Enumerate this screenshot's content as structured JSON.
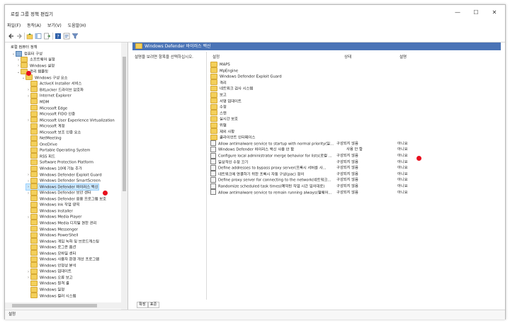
{
  "window": {
    "title": "로컬 그룹 정책 편집기",
    "minimize": "—",
    "maximize": "☐",
    "close": "✕"
  },
  "menu": [
    "파일(F)",
    "동작(A)",
    "보기(V)",
    "도움말(H)"
  ],
  "tree": [
    {
      "label": "로컬 컴퓨터 정책",
      "level": 0,
      "expander": "",
      "icon": "none"
    },
    {
      "label": "컴퓨터 구성",
      "level": 1,
      "expander": "⌄",
      "icon": "pc"
    },
    {
      "label": "소프트웨어 설정",
      "level": 2,
      "expander": "›",
      "icon": "folder"
    },
    {
      "label": "Windows 설정",
      "level": 2,
      "expander": "›",
      "icon": "folder"
    },
    {
      "label": "관리 템플릿",
      "level": 2,
      "expander": "⌄",
      "icon": "folder"
    },
    {
      "label": "Windows 구성 요소",
      "level": 3,
      "expander": "⌄",
      "icon": "folder"
    },
    {
      "label": "ActiveX Installer 서비스",
      "level": 4,
      "expander": "",
      "icon": "folder"
    },
    {
      "label": "BitLocker 드라이브 암호화",
      "level": 4,
      "expander": "›",
      "icon": "folder"
    },
    {
      "label": "Internet Explorer",
      "level": 4,
      "expander": "›",
      "icon": "folder"
    },
    {
      "label": "MDM",
      "level": 4,
      "expander": "",
      "icon": "folder"
    },
    {
      "label": "Microsoft Edge",
      "level": 4,
      "expander": "",
      "icon": "folder"
    },
    {
      "label": "Microsoft FIDO 인증",
      "level": 4,
      "expander": "",
      "icon": "folder"
    },
    {
      "label": "Microsoft User Experience Virtualization",
      "level": 4,
      "expander": "›",
      "icon": "folder"
    },
    {
      "label": "Microsoft 계정",
      "level": 4,
      "expander": "",
      "icon": "folder"
    },
    {
      "label": "Microsoft 보조 인증 요소",
      "level": 4,
      "expander": "",
      "icon": "folder"
    },
    {
      "label": "NetMeeting",
      "level": 4,
      "expander": "",
      "icon": "folder"
    },
    {
      "label": "OneDrive",
      "level": 4,
      "expander": "",
      "icon": "folder"
    },
    {
      "label": "Portable Operating System",
      "level": 4,
      "expander": "",
      "icon": "folder"
    },
    {
      "label": "RSS 피드",
      "level": 4,
      "expander": "",
      "icon": "folder"
    },
    {
      "label": "Software Protection Platform",
      "level": 4,
      "expander": "",
      "icon": "folder"
    },
    {
      "label": "Windows 10에 기능 추가",
      "level": 4,
      "expander": "",
      "icon": "folder"
    },
    {
      "label": "Windows Defender Exploit Guard",
      "level": 4,
      "expander": "›",
      "icon": "folder"
    },
    {
      "label": "Windows Defender SmartScreen",
      "level": 4,
      "expander": "›",
      "icon": "folder"
    },
    {
      "label": "Windows Defender 바이러스 백신",
      "level": 4,
      "expander": "›",
      "icon": "folder",
      "selected": true
    },
    {
      "label": "Windows Defender 보안 센터",
      "level": 4,
      "expander": "›",
      "icon": "folder"
    },
    {
      "label": "Windows Defender 응용 프로그램 보호",
      "level": 4,
      "expander": "",
      "icon": "folder"
    },
    {
      "label": "Windows Ink 작업 영역",
      "level": 4,
      "expander": "",
      "icon": "folder"
    },
    {
      "label": "Windows Installer",
      "level": 4,
      "expander": "",
      "icon": "folder"
    },
    {
      "label": "Windows Media Player",
      "level": 4,
      "expander": "›",
      "icon": "folder"
    },
    {
      "label": "Windows Media 디지털 권한 관리",
      "level": 4,
      "expander": "",
      "icon": "folder"
    },
    {
      "label": "Windows Messenger",
      "level": 4,
      "expander": "",
      "icon": "folder"
    },
    {
      "label": "Windows PowerShell",
      "level": 4,
      "expander": "",
      "icon": "folder"
    },
    {
      "label": "Windows 게임 녹화 및 브로드캐스팅",
      "level": 4,
      "expander": "",
      "icon": "folder"
    },
    {
      "label": "Windows 로그온 옵션",
      "level": 4,
      "expander": "",
      "icon": "folder"
    },
    {
      "label": "Windows 모바일 센터",
      "level": 4,
      "expander": "",
      "icon": "folder"
    },
    {
      "label": "Windows 사용자 환경 개선 프로그램",
      "level": 4,
      "expander": "",
      "icon": "folder"
    },
    {
      "label": "Windows 안정성 분석",
      "level": 4,
      "expander": "",
      "icon": "folder"
    },
    {
      "label": "Windows 업데이트",
      "level": 4,
      "expander": "›",
      "icon": "folder"
    },
    {
      "label": "Windows 오류 보고",
      "level": 4,
      "expander": "›",
      "icon": "folder"
    },
    {
      "label": "Windows 원격 셸",
      "level": 4,
      "expander": "",
      "icon": "folder"
    },
    {
      "label": "Windows 일정",
      "level": 4,
      "expander": "",
      "icon": "folder"
    },
    {
      "label": "Windows 컬러 시스템",
      "level": 4,
      "expander": "",
      "icon": "folder"
    }
  ],
  "right": {
    "header": "Windows Defender 바이러스 백신",
    "description": "설명을 보려면 항목을 선택하십시오.",
    "columns": {
      "setting": "설정",
      "state": "상태",
      "comment": "설명"
    },
    "folders": [
      "MAPS",
      "MpEngine",
      "Windows Defender Exploit Guard",
      "격리",
      "네트워크 검사 시스템",
      "보고",
      "서명 업데이트",
      "수정",
      "스캔",
      "실시간 보호",
      "위협",
      "제외 사항",
      "클라이언트 인터페이스"
    ],
    "settings": [
      {
        "name": "Allow antimalware service to startup with normal priority(일...",
        "state": "구성되지 않음",
        "comment": "아니요"
      },
      {
        "name": "Windows Defender 바이러스 백신 사용 안 함",
        "state": "사용 안 함",
        "comment": "아니요"
      },
      {
        "name": "Configure local administrator merge behavior for lists(로컬 ...",
        "state": "구성되지 않음",
        "comment": "아니요"
      },
      {
        "name": "일상적인 수정 끄기",
        "state": "구성되지 않음",
        "comment": "아니요"
      },
      {
        "name": "Define addresses to bypass proxy server(프록시 서버를 사...",
        "state": "구성되지 않음",
        "comment": "아니요"
      },
      {
        "name": "네트워크에 연결하기 위한 프록시 자동 구성(pac) 정의",
        "state": "구성되지 않음",
        "comment": "아니요"
      },
      {
        "name": "Define proxy server for connecting to the network(네트워크...",
        "state": "구성되지 않음",
        "comment": "아니요"
      },
      {
        "name": "Randomize scheduled task times(예약된 작업 시간 임의대로)",
        "state": "구성되지 않음",
        "comment": "아니요"
      },
      {
        "name": "Allow antimalware service to remain running always(맬웨어...",
        "state": "구성되지 않음",
        "comment": "아니요"
      }
    ]
  },
  "tabs": [
    "확장",
    "표준"
  ],
  "status": "설정",
  "colors": {
    "header_bg": "#4a74b6",
    "marker": "#e8101e",
    "folder": "#f3cf5a"
  }
}
